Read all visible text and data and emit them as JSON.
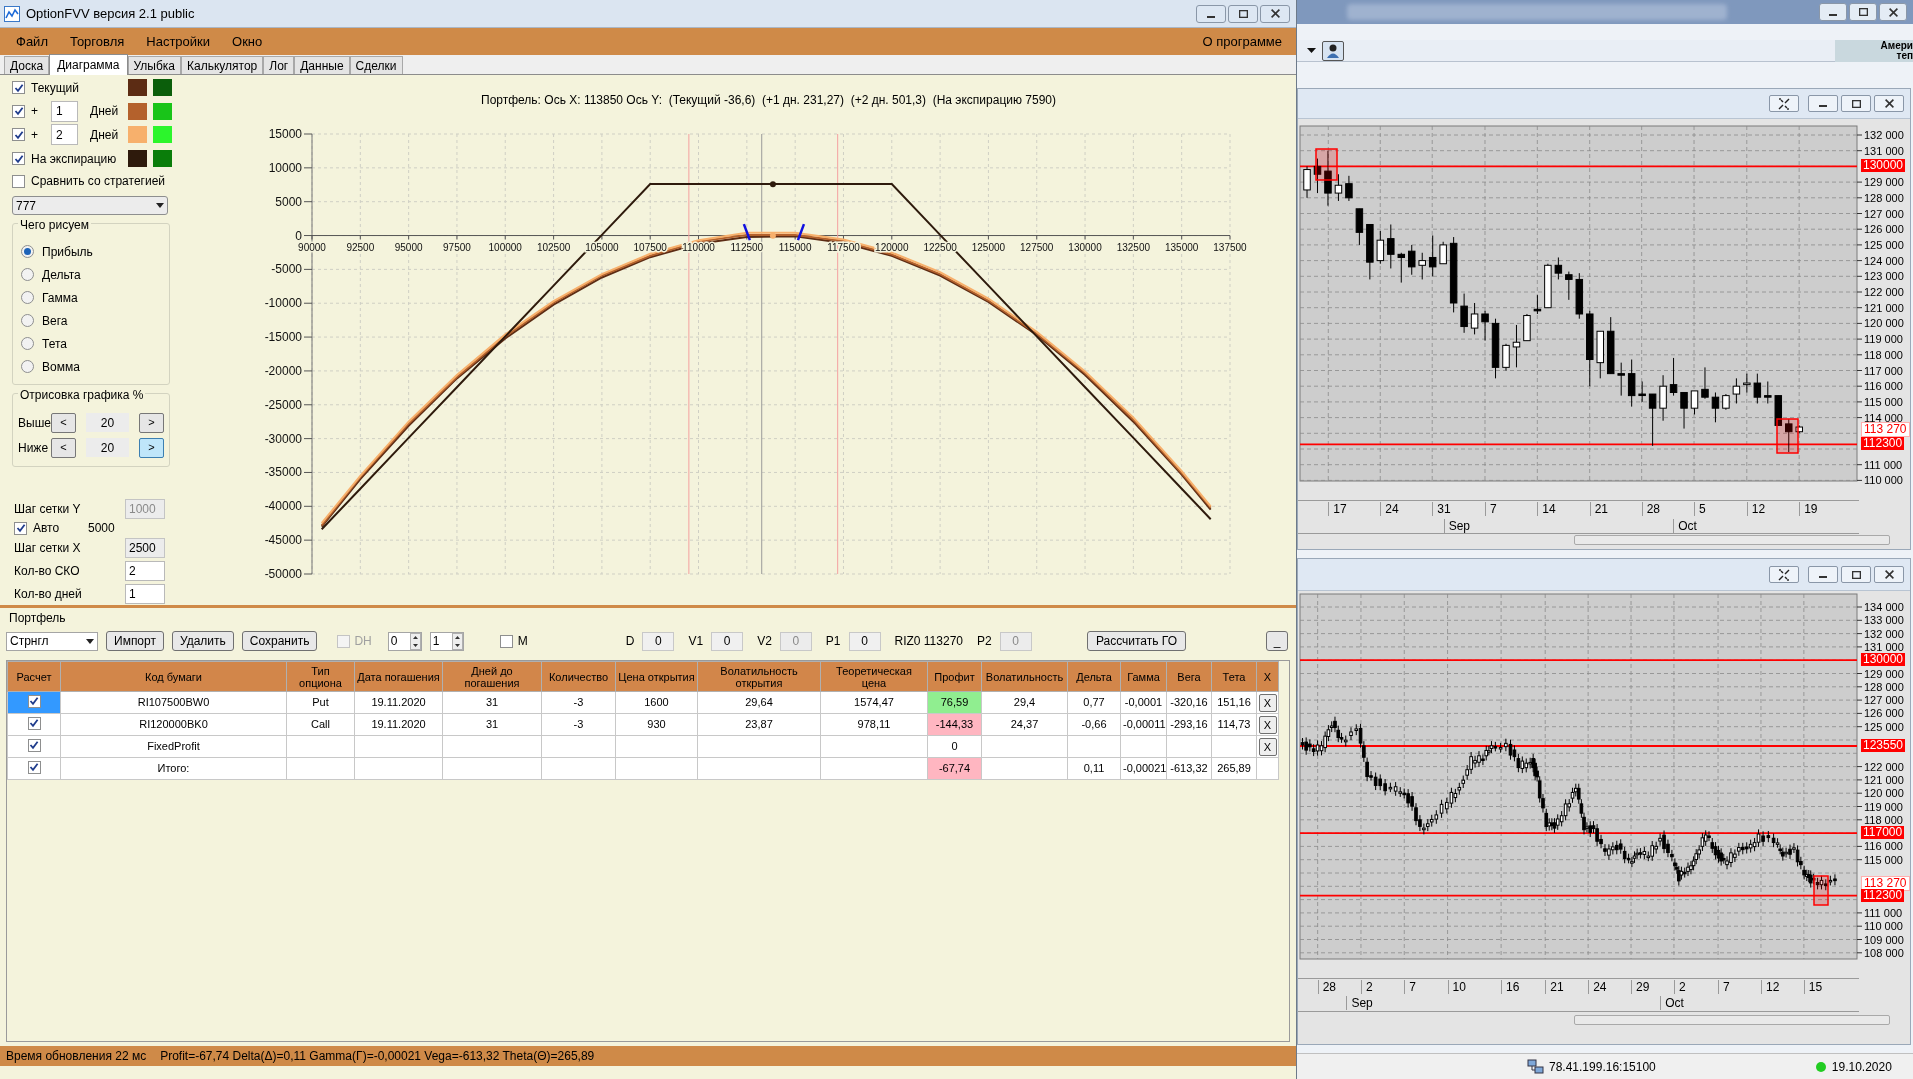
{
  "window": {
    "title": "OptionFVV версия 2.1 public"
  },
  "menu": [
    {
      "label": "Файл"
    },
    {
      "label": "Торговля"
    },
    {
      "label": "Настройки"
    },
    {
      "label": "Окно"
    }
  ],
  "menu_right": "О программе",
  "tabs": [
    {
      "label": "Доска",
      "selected": false
    },
    {
      "label": "Диаграмма",
      "selected": true
    },
    {
      "label": "Улыбка",
      "selected": false
    },
    {
      "label": "Калькулятор",
      "selected": false
    },
    {
      "label": "Лог",
      "selected": false
    },
    {
      "label": "Данные",
      "selected": false
    },
    {
      "label": "Сделки",
      "selected": false
    }
  ],
  "curves_panel": {
    "rows": [
      {
        "kind": "plain",
        "checked": true,
        "label": "Текущий",
        "swatches": [
          {
            "color": "#5c2c14"
          },
          {
            "color": "#0b5e0b"
          }
        ]
      },
      {
        "kind": "days",
        "checked": true,
        "prefix": "+",
        "days": "1",
        "unit": "Дней",
        "swatches": [
          {
            "color": "#b4612c"
          },
          {
            "color": "#19c419"
          }
        ]
      },
      {
        "kind": "days",
        "checked": true,
        "prefix": "+",
        "days": "2",
        "unit": "Дней",
        "swatches": [
          {
            "color": "#f7b06c"
          },
          {
            "color": "#2cf52c"
          }
        ]
      },
      {
        "kind": "plain",
        "checked": true,
        "label": "На экспирацию",
        "swatches": [
          {
            "color": "#2e1a0c"
          },
          {
            "color": "#0a7d0a"
          }
        ]
      }
    ],
    "compare": {
      "label": "Сравнить со стратегией",
      "checked": false
    },
    "strategy_select": "777"
  },
  "draw_group": {
    "title": "Чего рисуем",
    "options": [
      {
        "label": "Прибыль",
        "selected": true
      },
      {
        "label": "Дельта",
        "selected": false
      },
      {
        "label": "Гамма",
        "selected": false
      },
      {
        "label": "Вега",
        "selected": false
      },
      {
        "label": "Тета",
        "selected": false
      },
      {
        "label": "Вомма",
        "selected": false
      }
    ]
  },
  "range_group": {
    "title": "Отрисовка графика %",
    "rows": [
      {
        "label": "Выше",
        "prev": "<",
        "value": "20",
        "next": ">",
        "next_highlighted": false
      },
      {
        "label": "Ниже",
        "prev": "<",
        "value": "20",
        "next": ">",
        "next_highlighted": true
      }
    ]
  },
  "grid_settings": [
    {
      "kind": "field",
      "label": "Шаг сетки Y",
      "value": "1000",
      "disabled": true,
      "read_only": true
    },
    {
      "kind": "checkbox",
      "label": "Авто",
      "checked": true,
      "value": "5000"
    },
    {
      "kind": "field",
      "label": "Шаг сетки X",
      "value": "2500",
      "disabled": false,
      "read_only": true
    },
    {
      "kind": "field",
      "label": "Кол-во СКО",
      "value": "2",
      "disabled": false,
      "read_only": false
    },
    {
      "kind": "field",
      "label": "Кол-во дней",
      "value": "1",
      "disabled": false,
      "read_only": false
    }
  ],
  "payoff_chart": {
    "chart_data": {
      "type": "line",
      "title": "Портфель: Ось X: 113850 Ось Y:  (Текущий -36,6)  (+1 дн. 231,27)  (+2 дн. 501,3)  (На экспирацию 7590)",
      "x": [
        90500,
        92500,
        95000,
        97500,
        100000,
        102500,
        105000,
        107500,
        110000,
        112500,
        115000,
        117500,
        120000,
        122500,
        125000,
        127500,
        130000,
        132500,
        135000,
        136500
      ],
      "series": [
        {
          "color": "#5c2c14",
          "values": [
            -43000,
            -36000,
            -28100,
            -21100,
            -15200,
            -10200,
            -6200,
            -3200,
            -1200,
            -200,
            -100,
            -1100,
            -3000,
            -5900,
            -9800,
            -14700,
            -20600,
            -27500,
            -35300,
            -40500
          ]
        },
        {
          "color": "#b4612c",
          "values": [
            -42800,
            -35700,
            -27800,
            -20900,
            -14900,
            -9900,
            -5900,
            -3000,
            -900,
            100,
            100,
            -800,
            -2800,
            -5700,
            -9600,
            -14500,
            -20300,
            -27200,
            -35100,
            -40200
          ]
        },
        {
          "color": "#f7b06c",
          "values": [
            -42500,
            -35500,
            -27500,
            -20600,
            -14600,
            -9700,
            -5700,
            -2700,
            -700,
            400,
            400,
            -600,
            -2500,
            -5400,
            -9300,
            -14200,
            -20100,
            -26900,
            -34800,
            -40000
          ]
        },
        {
          "color": "#2e1a0c",
          "values": [
            -43400,
            -37400,
            -29900,
            -22400,
            -14900,
            -7400,
            100,
            7600,
            7600,
            7600,
            7600,
            7600,
            7600,
            100,
            -7400,
            -14900,
            -22400,
            -29900,
            -37400,
            -41900
          ]
        }
      ],
      "xlim": [
        90000,
        137500
      ],
      "ylim": [
        -50000,
        15000
      ],
      "xticks": [
        90000,
        92500,
        95000,
        97500,
        100000,
        102500,
        105000,
        107500,
        110000,
        112500,
        115000,
        117500,
        120000,
        122500,
        125000,
        127500,
        130000,
        132500,
        135000,
        137500
      ],
      "yticks": [
        -50000,
        -45000,
        -40000,
        -35000,
        -30000,
        -25000,
        -20000,
        -15000,
        -10000,
        -5000,
        0,
        5000,
        10000,
        15000
      ],
      "grid": true,
      "ref_lines": [
        {
          "axis": "x",
          "value": 109500,
          "color": "#f4a0a0"
        },
        {
          "axis": "x",
          "value": 117200,
          "color": "#f4a0a0"
        },
        {
          "axis": "x",
          "value": 113270,
          "color": "#9a9a9a"
        }
      ]
    }
  },
  "portfolio": {
    "title": "Портфель",
    "strategy": "Стрнгл",
    "buttons": [
      "Импорт",
      "Удалить",
      "Сохранить"
    ],
    "dh": {
      "label": "DH",
      "checked": false,
      "disabled": true
    },
    "spinners": [
      "0",
      "1"
    ],
    "m": {
      "label": "M",
      "checked": false
    },
    "params": [
      {
        "kind": "field",
        "label": "D",
        "value": "0",
        "disabled": false
      },
      {
        "kind": "field",
        "label": "V1",
        "value": "0",
        "disabled": false
      },
      {
        "kind": "field",
        "label": "V2",
        "value": "0",
        "disabled": true
      },
      {
        "kind": "field",
        "label": "P1",
        "value": "0",
        "disabled": false
      },
      {
        "kind": "text",
        "text": "RIZ0 113270"
      },
      {
        "kind": "field",
        "label": "P2",
        "value": "0",
        "disabled": true
      }
    ],
    "calc_button": "Рассчитать ГО",
    "minimize_button": "_"
  },
  "table": {
    "columns": [
      "Расчет",
      "Код бумаги",
      "Тип опциона",
      "Дата погашения",
      "Дней до погашения",
      "Количество",
      "Цена открытия",
      "Волатильность открытия",
      "Теоретическая цена",
      "Профит",
      "Волатильность",
      "Дельта",
      "Гамма",
      "Вега",
      "Тета",
      "X"
    ],
    "rows": [
      {
        "checked": true,
        "selected": true,
        "profit_gain": true,
        "profit_loss": false,
        "cells": [
          null,
          "RI107500BW0",
          "Put",
          "19.11.2020",
          "31",
          "-3",
          "1600",
          "29,64",
          "1574,47",
          "76,59",
          "29,4",
          "0,77",
          "-0,0001",
          "-320,16",
          "151,16",
          "X"
        ]
      },
      {
        "checked": true,
        "selected": false,
        "profit_gain": false,
        "profit_loss": true,
        "cells": [
          null,
          "RI120000BK0",
          "Call",
          "19.11.2020",
          "31",
          "-3",
          "930",
          "23,87",
          "978,11",
          "-144,33",
          "24,37",
          "-0,66",
          "-0,00011",
          "-293,16",
          "114,73",
          "X"
        ]
      },
      {
        "checked": true,
        "selected": false,
        "profit_gain": false,
        "profit_loss": false,
        "cells": [
          null,
          "FixedProfit",
          null,
          null,
          null,
          null,
          null,
          null,
          null,
          "0",
          null,
          null,
          null,
          null,
          null,
          "X"
        ]
      },
      {
        "checked": true,
        "selected": false,
        "profit_gain": false,
        "profit_loss": true,
        "cells": [
          null,
          "Итого:",
          null,
          null,
          null,
          null,
          null,
          null,
          null,
          "-67,74",
          null,
          "0,11",
          "-0,00021",
          "-613,32",
          "265,89",
          null
        ]
      }
    ]
  },
  "status_bar": {
    "timing": "Время обновления 22 мс",
    "summary": "Profit=-67,74 Delta(Δ)=0,11 Gamma(Γ)=-0,00021 Vega=-613,32 Theta(Θ)=265,89"
  },
  "background_app": {
    "banner": [
      "Амери",
      "теп"
    ],
    "charts": [
      {
        "y_ticks": [
          "132 000",
          "131 000",
          "129 000",
          "128 000",
          "127 000",
          "126 000",
          "125 000",
          "124 000",
          "123 000",
          "122 000",
          "121 000",
          "120 000",
          "119 000",
          "118 000",
          "117 000",
          "116 000",
          "115 000",
          "114 000",
          "111 000",
          "110 000"
        ],
        "price_tags": [
          {
            "text": "130000",
            "kind": "line"
          },
          {
            "text": "113 270",
            "kind": "last"
          },
          {
            "text": "112300",
            "kind": "line"
          }
        ],
        "x_labels": [
          "17",
          "24",
          "31",
          "7",
          "14",
          "21",
          "28",
          "5",
          "12",
          "19"
        ],
        "months": [
          "Sep",
          "Oct"
        ]
      },
      {
        "y_ticks": [
          "134 000",
          "133 000",
          "132 000",
          "131 000",
          "129 000",
          "128 000",
          "127 000",
          "126 000",
          "125 000",
          "122 000",
          "121 000",
          "120 000",
          "119 000",
          "118 000",
          "116 000",
          "115 000",
          "111 000",
          "110 000",
          "109 000",
          "108 000"
        ],
        "price_tags": [
          {
            "text": "130000",
            "kind": "line"
          },
          {
            "text": "123550",
            "kind": "line"
          },
          {
            "text": "117000",
            "kind": "line"
          },
          {
            "text": "113 270",
            "kind": "last"
          },
          {
            "text": "112300",
            "kind": "line"
          }
        ],
        "x_labels": [
          "28",
          "2",
          "7",
          "10",
          "16",
          "21",
          "24",
          "29",
          "2",
          "7",
          "12",
          "15"
        ],
        "months": [
          "Sep",
          "Oct"
        ]
      }
    ],
    "status": {
      "address": "78.41.199.16:15100",
      "date": "19.10.2020"
    }
  }
}
